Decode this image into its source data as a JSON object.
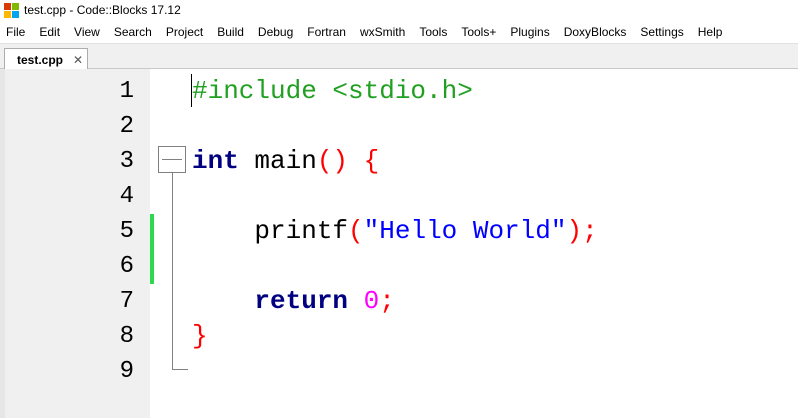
{
  "window": {
    "title": "test.cpp - Code::Blocks 17.12",
    "icon": "codeblocks-logo-icon"
  },
  "menu": [
    "File",
    "Edit",
    "View",
    "Search",
    "Project",
    "Build",
    "Debug",
    "Fortran",
    "wxSmith",
    "Tools",
    "Tools+",
    "Plugins",
    "DoxyBlocks",
    "Settings",
    "Help"
  ],
  "tab": {
    "label": "test.cpp",
    "close": "✕"
  },
  "line_numbers": [
    "1",
    "2",
    "3",
    "4",
    "5",
    "6",
    "7",
    "8",
    "9"
  ],
  "code": {
    "line1": {
      "directive": "#include <stdio.h>"
    },
    "line3": {
      "kw": "int",
      "ident": " main",
      "paren": "()",
      "space": " ",
      "brace": "{"
    },
    "line5": {
      "indent": "    ",
      "ident": "printf",
      "open": "(",
      "str": "\"Hello World\"",
      "close": ");"
    },
    "line7": {
      "indent": "    ",
      "kw": "return",
      "space": " ",
      "num": "0",
      "semi": ";"
    },
    "line8": {
      "brace": "}"
    }
  },
  "colors": {
    "preprocessor": "#20a020",
    "keyword": "#000080",
    "operator": "#ff0000",
    "string": "#0000ff",
    "number": "#ff00ff",
    "change_marker": "#2fd94f"
  }
}
